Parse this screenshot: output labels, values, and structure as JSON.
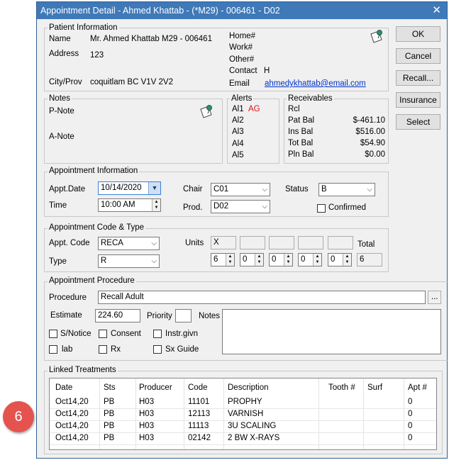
{
  "window": {
    "title": "Appointment Detail - Ahmed Khattab - (*M29) - 006461 - D02",
    "close_glyph": "✕"
  },
  "patient_info": {
    "group_label": "Patient Information",
    "name_label": "Name",
    "name_value": "Mr. Ahmed Khattab  M29 - 006461",
    "address_label": "Address",
    "address_value": "123",
    "cityprov_label": "City/Prov",
    "cityprov_value": "coquitlam BC V1V 2V2",
    "home_label": "Home#",
    "work_label": "Work#",
    "other_label": "Other#",
    "contact_label": "Contact",
    "contact_value": "H",
    "email_label": "Email",
    "email_value": "ahmedykhattab@email.com"
  },
  "buttons": {
    "ok": "OK",
    "cancel": "Cancel",
    "recall": "Recall...",
    "insurance": "Insurance",
    "select": "Select"
  },
  "notes": {
    "group_label": "Notes",
    "p_note": "P-Note",
    "a_note": "A-Note"
  },
  "alerts": {
    "group_label": "Alerts",
    "items": [
      {
        "label": "Al1",
        "value": "AG"
      },
      {
        "label": "Al2",
        "value": ""
      },
      {
        "label": "Al3",
        "value": ""
      },
      {
        "label": "Al4",
        "value": ""
      },
      {
        "label": "Al5",
        "value": ""
      }
    ]
  },
  "receivables": {
    "group_label": "Receivables",
    "rcl_label": "Rcl",
    "rows": [
      {
        "label": "Pat Bal",
        "value": "$-461.10"
      },
      {
        "label": "Ins Bal",
        "value": "$516.00"
      },
      {
        "label": "Tot Bal",
        "value": "$54.90"
      },
      {
        "label": "Pln Bal",
        "value": "$0.00"
      }
    ]
  },
  "appt_info": {
    "group_label": "Appointment Information",
    "date_label": "Appt.Date",
    "date_value": "10/14/2020",
    "time_label": "Time",
    "time_value": "10:00 AM",
    "chair_label": "Chair",
    "chair_value": "C01",
    "prod_label": "Prod.",
    "prod_value": "D02",
    "status_label": "Status",
    "status_value": "B",
    "confirmed_label": "Confirmed"
  },
  "code_type": {
    "group_label": "Appointment Code & Type",
    "code_label": "Appt. Code",
    "code_value": "RECA",
    "type_label": "Type",
    "type_value": "R",
    "units_label": "Units",
    "total_label": "Total",
    "unit_boxes": [
      "X",
      "",
      "",
      "",
      ""
    ],
    "spinners": [
      "6",
      "0",
      "0",
      "0",
      "0"
    ],
    "total_value": "6"
  },
  "procedure": {
    "group_label": "Appointment Procedure",
    "procedure_label": "Procedure",
    "procedure_value": "Recall Adult",
    "browse": "...",
    "estimate_label": "Estimate",
    "estimate_value": "224.60",
    "priority_label": "Priority",
    "priority_value": "",
    "notes_label": "Notes",
    "checkboxes": [
      "S/Notice",
      "Consent",
      "Instr.givn",
      "lab",
      "Rx",
      "Sx Guide"
    ]
  },
  "linked": {
    "group_label": "Linked Treatments",
    "columns": [
      "Date",
      "Sts",
      "Producer",
      "Code",
      "Description",
      "Tooth #",
      "Surf",
      "Apt #"
    ],
    "rows": [
      [
        "Oct14,20",
        "PB",
        "H03",
        "11101",
        "PROPHY",
        "",
        "",
        "0"
      ],
      [
        "Oct14,20",
        "PB",
        "H03",
        "12113",
        "VARNISH",
        "",
        "",
        "0"
      ],
      [
        "Oct14,20",
        "PB",
        "H03",
        "11113",
        "3U SCALING",
        "",
        "",
        "0"
      ],
      [
        "Oct14,20",
        "PB",
        "H03",
        "02142",
        "2 BW X-RAYS",
        "",
        "",
        "0"
      ]
    ]
  },
  "callout": {
    "number": "6",
    "color": "#e5534f"
  },
  "colors": {
    "titlebar": "#3f79b8",
    "window_bg": "#f0f0f0",
    "alert_red": "#d11111",
    "link": "#0033cc"
  }
}
